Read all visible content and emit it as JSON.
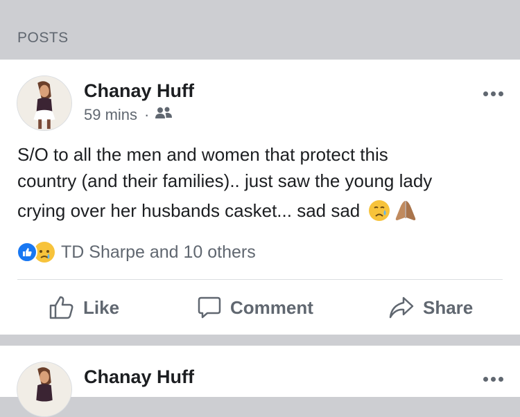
{
  "section": {
    "title": "POSTS"
  },
  "posts": [
    {
      "author": "Chanay Huff",
      "time": "59 mins",
      "separator": "·",
      "audience_icon": "friends-icon",
      "text_line1": "S/O to all the men and women that protect this",
      "text_line2": "country (and their families).. just saw the young lady",
      "text_line3": "crying over her husbands casket... sad sad",
      "emojis": [
        "crying-face-emoji",
        "folded-hands-emoji"
      ],
      "reactions": {
        "icons": [
          "like-icon",
          "sad-icon"
        ],
        "summary": "TD Sharpe and 10 others"
      },
      "actions": {
        "like": "Like",
        "comment": "Comment",
        "share": "Share"
      }
    },
    {
      "author": "Chanay Huff"
    }
  ],
  "colors": {
    "accent": "#1877f2",
    "background": "#cdced2",
    "text": "#1c1e21",
    "muted": "#606770"
  }
}
